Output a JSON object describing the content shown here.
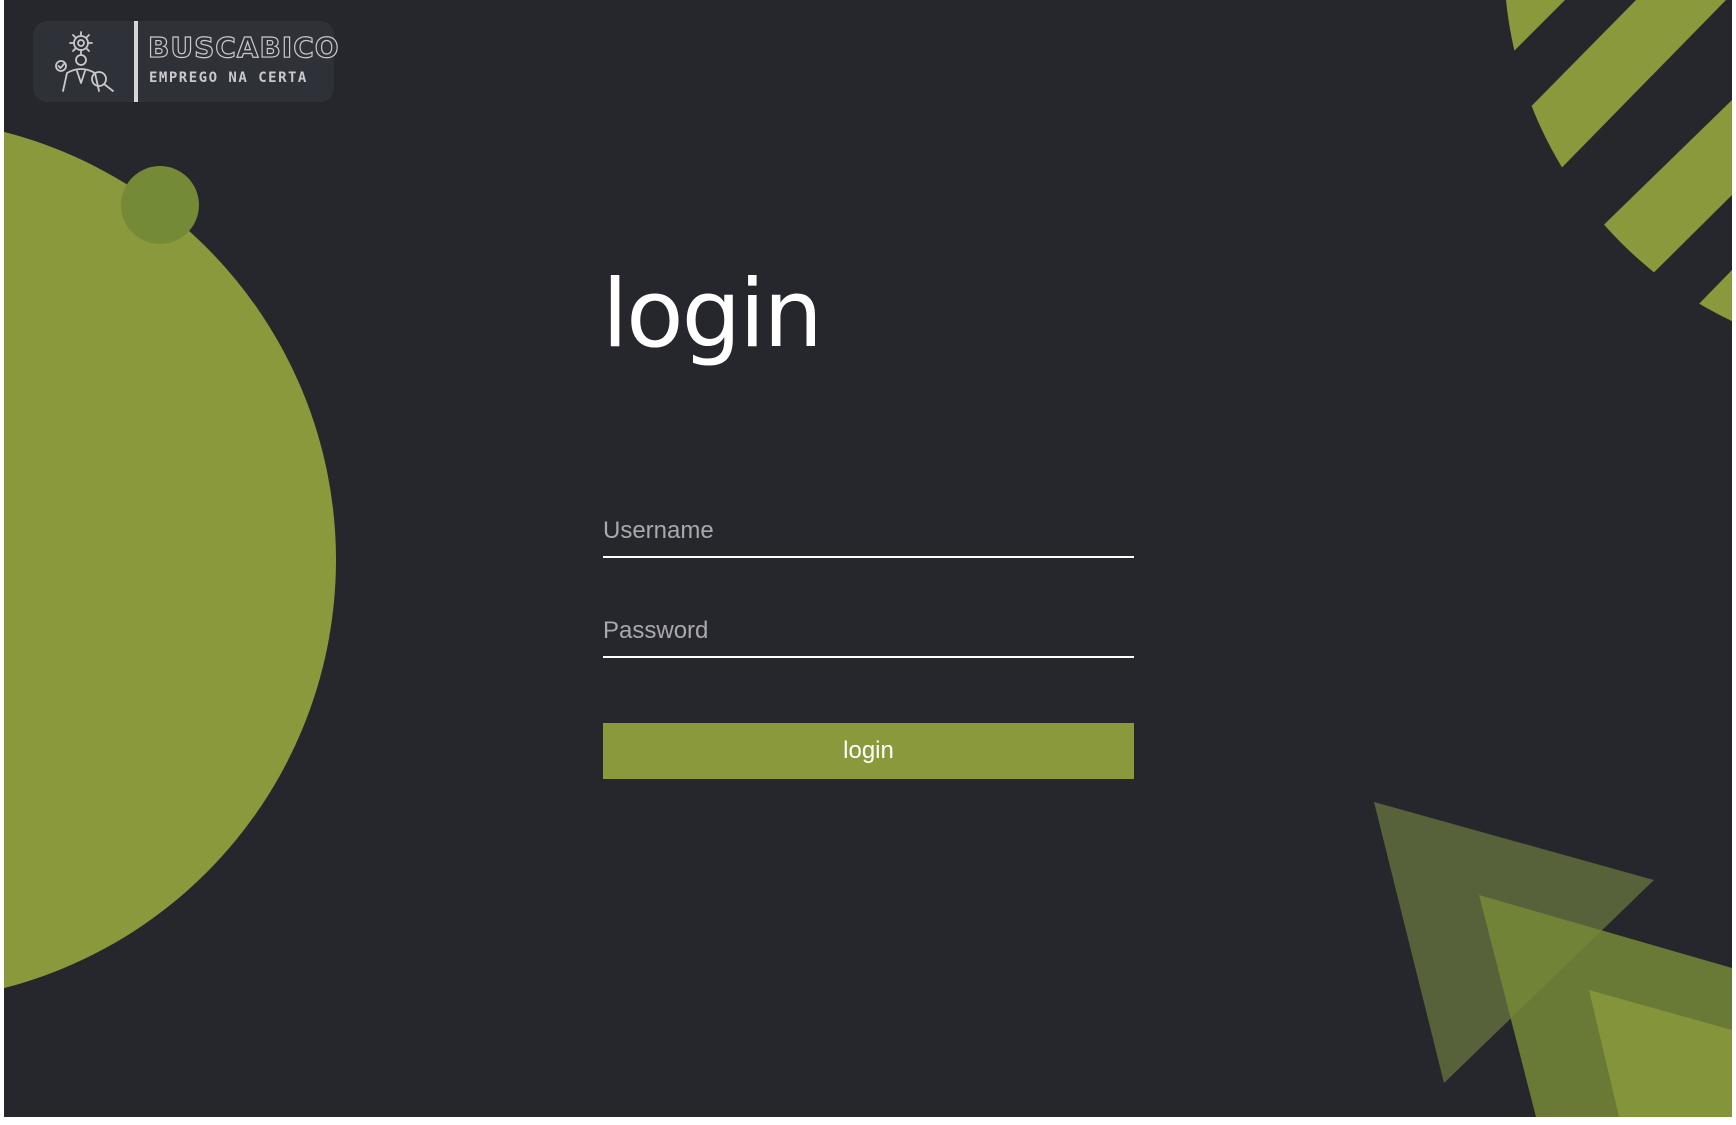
{
  "brand": {
    "name": "BUSCABICO",
    "tagline": "EMPREGO NA CERTA"
  },
  "form": {
    "heading": "login",
    "username_placeholder": "Username",
    "password_placeholder": "Password",
    "username_value": "",
    "password_value": "",
    "submit_label": "login"
  },
  "icons": {
    "logo": "job-seeker-magnifier-icon"
  },
  "colors": {
    "background": "#26262d",
    "accent": "#8a993b",
    "accent_dark": "#57613a",
    "accent_mid": "#748a37",
    "text": "#ffffff",
    "placeholder": "#a8a8ad"
  }
}
